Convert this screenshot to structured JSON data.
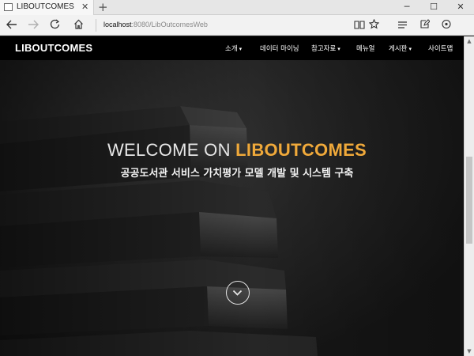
{
  "browser": {
    "tab_title": "LIBOUTCOMES",
    "tab_close": "✕",
    "new_tab": "+",
    "url_host": "localhost",
    "url_path": ":8080/LibOutcomesWeb"
  },
  "site": {
    "brand": "LIBOUTCOMES",
    "menu": [
      {
        "label": "소개",
        "caret": "▾"
      },
      {
        "label": "데이터 마이닝",
        "caret": ""
      },
      {
        "label": "참고자료",
        "caret": "▾"
      },
      {
        "label": "메뉴얼",
        "caret": ""
      },
      {
        "label": "게시판",
        "caret": "▾"
      },
      {
        "label": "사이트맵",
        "caret": ""
      }
    ]
  },
  "hero": {
    "title_prefix": "WELCOME ON ",
    "title_accent": "LIBOUTCOMES",
    "subtitle": "공공도서관 서비스 가치평가 모델 개발 및 시스템 구축"
  },
  "colors": {
    "accent": "#f0a93a",
    "navbar": "#000000"
  },
  "icons": {
    "back": "arrow-left-icon",
    "forward": "arrow-right-icon",
    "refresh": "refresh-icon",
    "home": "home-icon",
    "reading_view": "book-icon",
    "favorite": "star-icon",
    "hub": "hub-lines-icon",
    "web_note": "pen-note-icon",
    "share": "share-icon",
    "scroll_down": "chevron-down-circle-icon"
  }
}
